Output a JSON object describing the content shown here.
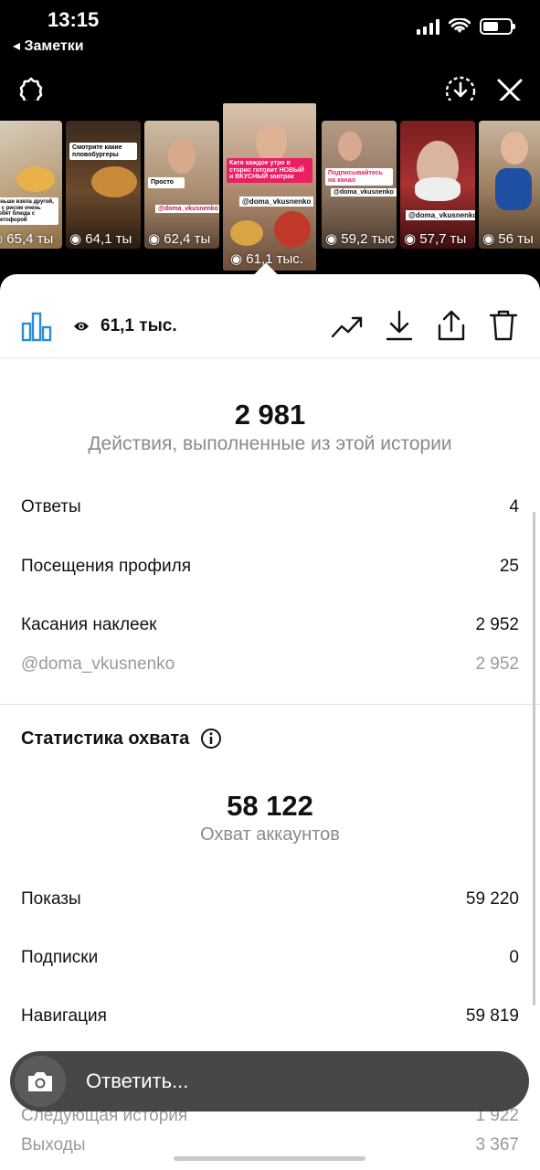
{
  "status": {
    "time": "13:15",
    "back_app": "◂ Заметки"
  },
  "carousel": {
    "thumbs": [
      {
        "views": "65,4 ты",
        "caption": "Раньше взяла другой, не с рисом очень любят блюда с светофорой"
      },
      {
        "views": "64,1 ты",
        "caption": "Смотрите какие пловобургеры"
      },
      {
        "views": "62,4 ты",
        "caption": "Просто",
        "tag": "@doma_vkusnenko"
      },
      {
        "views": "61,1 тыс.",
        "caption": "Катя каждое утро в сторис готовит НОВЫЙ и ВКУСНЫЙ завтрак",
        "tag": "@doma_vkusnenko"
      },
      {
        "views": "59,2 тыс",
        "caption": "Подписывайтесь на канал",
        "tag": "@doma_vkusnenko"
      },
      {
        "views": "57,7 ты",
        "tag": "@doma_vkusnenko"
      },
      {
        "views": "56 ты"
      }
    ]
  },
  "toolbar": {
    "views": "61,1 тыс."
  },
  "actions": {
    "value": "2 981",
    "label": "Действия, выполненные из этой истории",
    "rows": [
      {
        "label": "Ответы",
        "value": "4"
      },
      {
        "label": "Посещения профиля",
        "value": "25"
      },
      {
        "label": "Касания наклеек",
        "value": "2 952"
      },
      {
        "label": "@doma_vkusnenko",
        "value": "2 952"
      }
    ]
  },
  "reach": {
    "title": "Статистика охвата",
    "value": "58 122",
    "label": "Охват аккаунтов",
    "rows": [
      {
        "label": "Показы",
        "value": "59 220"
      },
      {
        "label": "Подписки",
        "value": "0"
      },
      {
        "label": "Навигация",
        "value": "59 819"
      },
      {
        "label": "Следующая история",
        "value": "1 922"
      },
      {
        "label": "Выходы",
        "value": "3 367"
      }
    ]
  },
  "reply": {
    "placeholder": "Ответить..."
  }
}
